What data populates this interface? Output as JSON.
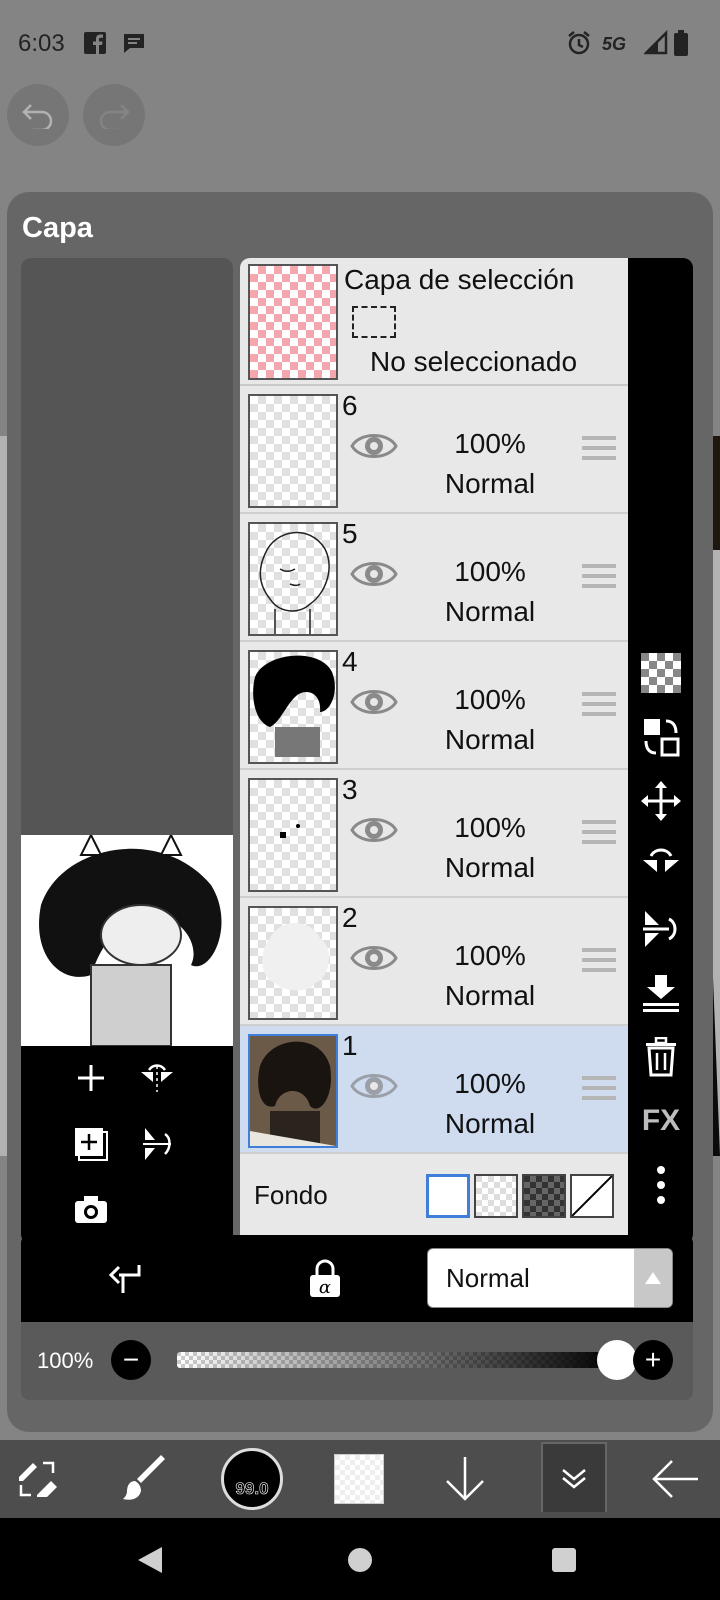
{
  "status_bar": {
    "time": "6:03",
    "network": "5G",
    "icons": [
      "facebook-icon",
      "message-icon",
      "alarm-icon",
      "signal-icon",
      "battery-icon"
    ]
  },
  "top_controls": {
    "undo_icon": "undo-icon",
    "redo_icon": "redo-icon"
  },
  "panel": {
    "title": "Capa",
    "selection_layer": {
      "title": "Capa de selección",
      "status": "No seleccionado"
    },
    "layers": [
      {
        "number": "6",
        "opacity": "100%",
        "mode": "Normal",
        "visible": true,
        "active": false
      },
      {
        "number": "5",
        "opacity": "100%",
        "mode": "Normal",
        "visible": true,
        "active": false
      },
      {
        "number": "4",
        "opacity": "100%",
        "mode": "Normal",
        "visible": true,
        "active": false
      },
      {
        "number": "3",
        "opacity": "100%",
        "mode": "Normal",
        "visible": true,
        "active": false
      },
      {
        "number": "2",
        "opacity": "100%",
        "mode": "Normal",
        "visible": true,
        "active": false
      },
      {
        "number": "1",
        "opacity": "100%",
        "mode": "Normal",
        "visible": true,
        "active": true
      }
    ],
    "background": {
      "label": "Fondo",
      "options": [
        "white",
        "transparent",
        "dark-checker",
        "diagonal"
      ],
      "selected": "white"
    },
    "right_tools": {
      "fx_label": "FX"
    },
    "blend_mode": {
      "value": "Normal"
    },
    "opacity": {
      "label": "100%",
      "value": 100,
      "minus": "−",
      "plus": "+"
    }
  },
  "bottom_toolbar": {
    "brush_size": "99.0"
  },
  "colors": {
    "panel_bg": "#666666",
    "active_layer": "#cfdcf0",
    "accent_blue": "#3f7fd9",
    "selection_pink": "#f4a7ad"
  }
}
